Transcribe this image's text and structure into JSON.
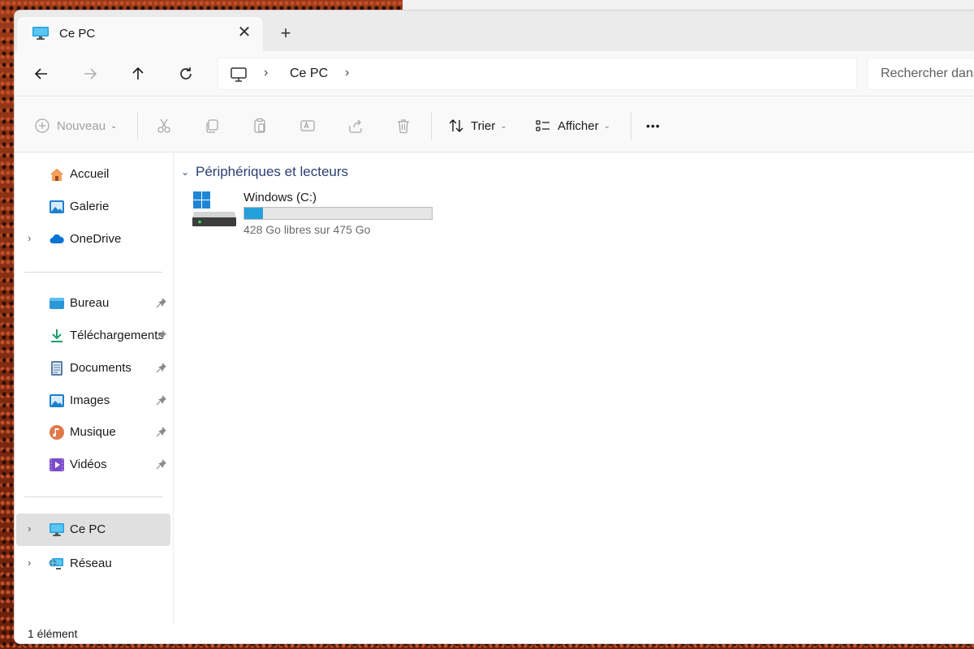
{
  "tab": {
    "title": "Ce PC",
    "close_glyph": "✕",
    "new_tab_glyph": "+"
  },
  "address": {
    "icon": "pc-icon",
    "path": [
      "Ce PC"
    ],
    "separator": "›",
    "search_placeholder": "Rechercher dans : Ce PC"
  },
  "nav_buttons": [
    "back",
    "forward",
    "up",
    "refresh"
  ],
  "commands": {
    "new_label": "Nouveau",
    "sort_label": "Trier",
    "view_label": "Afficher",
    "more_glyph": "•••",
    "disabled_icons": [
      "cut-icon",
      "copy-icon",
      "paste-icon",
      "rename-icon",
      "share-icon",
      "delete-icon"
    ]
  },
  "sidebar": {
    "quick": [
      {
        "label": "Accueil",
        "icon": "home-icon"
      },
      {
        "label": "Galerie",
        "icon": "gallery-icon"
      },
      {
        "label": "OneDrive",
        "icon": "onedrive-icon",
        "expandable": true
      }
    ],
    "pinned": [
      {
        "label": "Bureau",
        "icon": "desktop-folder-icon"
      },
      {
        "label": "Téléchargements",
        "icon": "downloads-icon"
      },
      {
        "label": "Documents",
        "icon": "documents-icon"
      },
      {
        "label": "Images",
        "icon": "pictures-icon"
      },
      {
        "label": "Musique",
        "icon": "music-icon"
      },
      {
        "label": "Vidéos",
        "icon": "videos-icon"
      }
    ],
    "locations": [
      {
        "label": "Ce PC",
        "icon": "pc-icon",
        "selected": true
      },
      {
        "label": "Réseau",
        "icon": "network-icon"
      }
    ],
    "expand_glyph": "›"
  },
  "content": {
    "group_title": "Périphériques et lecteurs",
    "group_chevron": "⌄",
    "drives": [
      {
        "name": "Windows (C:)",
        "free_text": "428 Go libres sur 475 Go",
        "used_fraction": 0.099
      }
    ]
  },
  "status": {
    "count_text": "1 élément"
  },
  "colors": {
    "accent": "#26a0da",
    "group_title": "#2b3f73",
    "selected_bg": "#e0e0e0"
  }
}
